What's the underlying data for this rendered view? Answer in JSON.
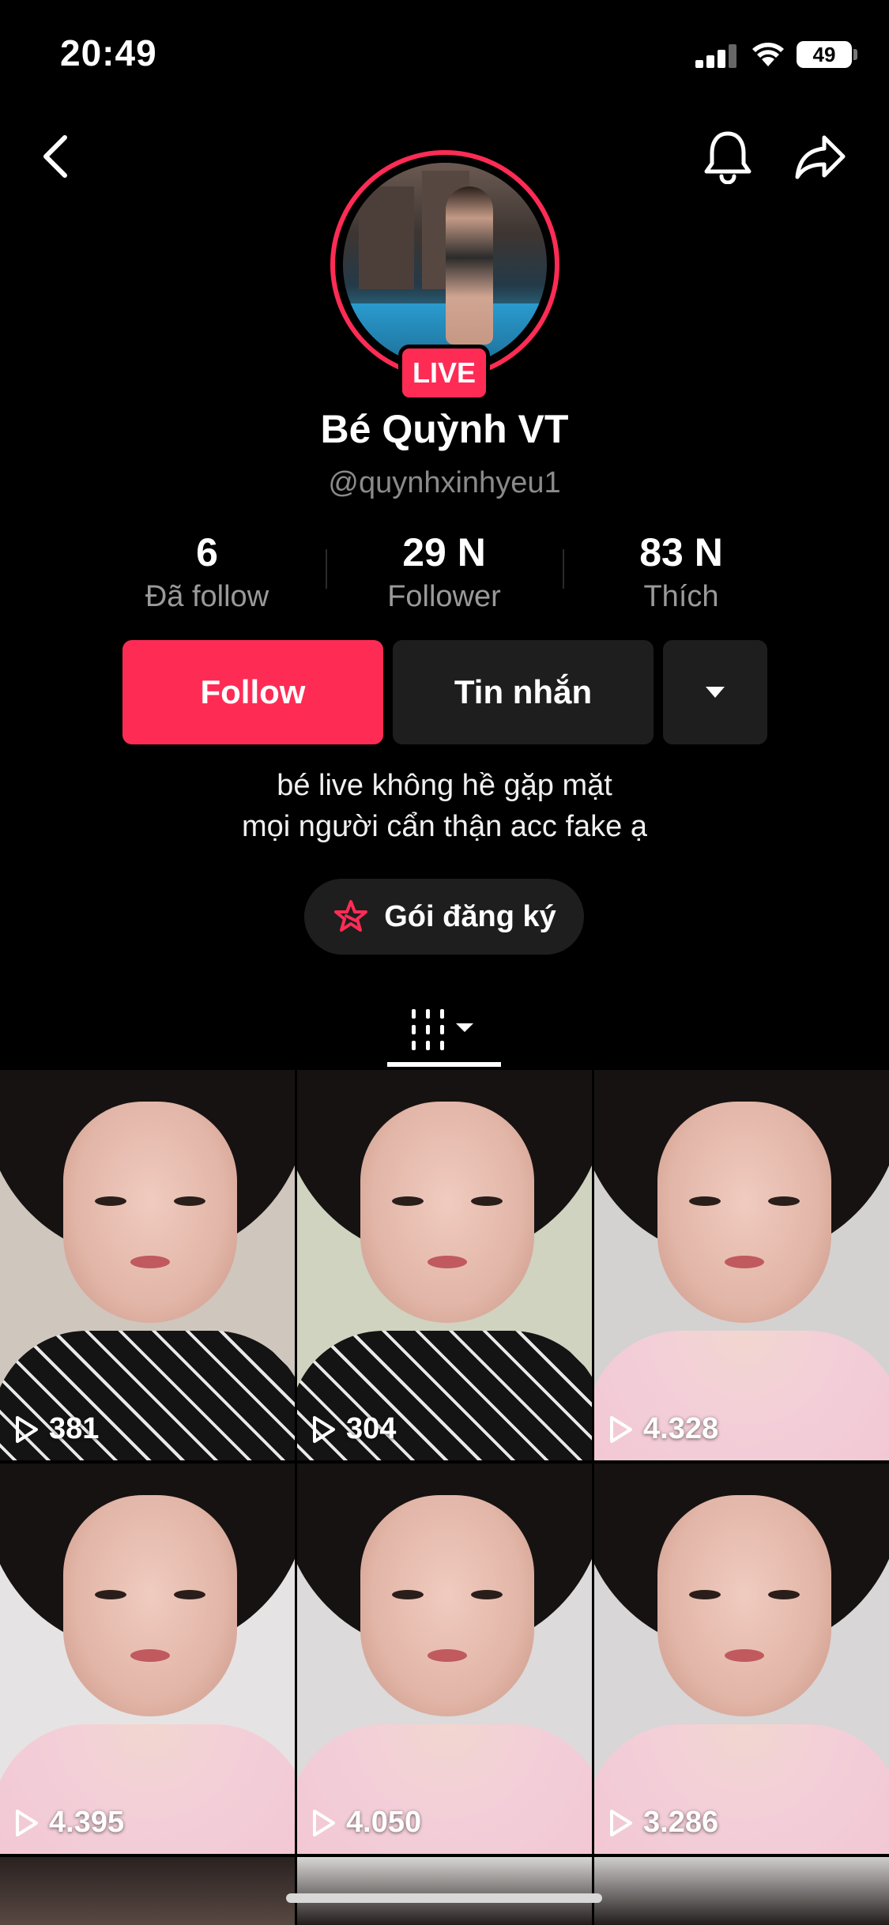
{
  "status": {
    "time": "20:49",
    "battery": "49"
  },
  "profile": {
    "display_name": "Bé Quỳnh VT",
    "username": "@quynhxinhyeu1",
    "live_label": "LIVE",
    "stats": [
      {
        "value": "6",
        "label": "Đã follow"
      },
      {
        "value": "29 N",
        "label": "Follower"
      },
      {
        "value": "83 N",
        "label": "Thích"
      }
    ],
    "bio_line1": "bé live không hề gặp mặt",
    "bio_line2": "mọi người cẩn thận acc fake ạ"
  },
  "actions": {
    "follow_label": "Follow",
    "message_label": "Tin nhắn",
    "subscribe_label": "Gói đăng ký"
  },
  "colors": {
    "accent": "#fe2c55",
    "background": "#000000",
    "button_dark": "#1e1e1e"
  },
  "videos": [
    {
      "plays": "381",
      "style": "dark"
    },
    {
      "plays": "304",
      "style": "dark"
    },
    {
      "plays": "4.328",
      "style": "pink"
    },
    {
      "plays": "4.395",
      "style": "pink"
    },
    {
      "plays": "4.050",
      "style": "pink"
    },
    {
      "plays": "3.286",
      "style": "pink"
    }
  ]
}
